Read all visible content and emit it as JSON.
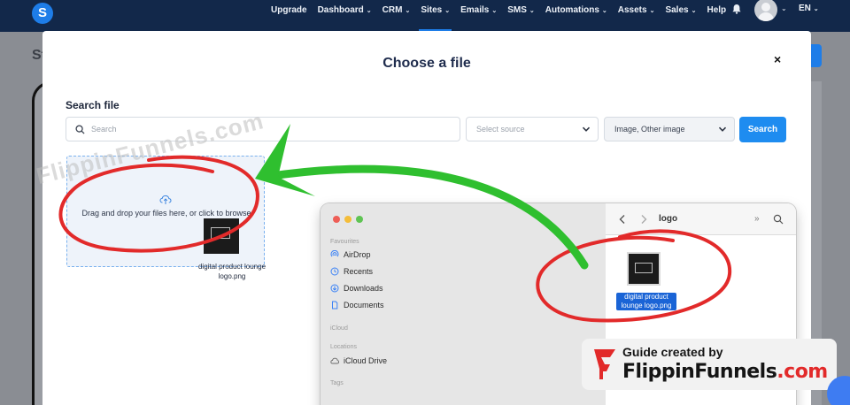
{
  "nav": {
    "logo_letter": "S",
    "items": [
      {
        "label": "Upgrade",
        "dropdown": false
      },
      {
        "label": "Dashboard",
        "dropdown": true
      },
      {
        "label": "CRM",
        "dropdown": true
      },
      {
        "label": "Sites",
        "dropdown": true,
        "active": true
      },
      {
        "label": "Emails",
        "dropdown": true
      },
      {
        "label": "SMS",
        "dropdown": true
      },
      {
        "label": "Automations",
        "dropdown": true
      },
      {
        "label": "Assets",
        "dropdown": true
      },
      {
        "label": "Sales",
        "dropdown": true
      },
      {
        "label": "Help",
        "dropdown": false
      }
    ],
    "language": "EN",
    "icons": {
      "bell": "bell-icon",
      "avatar": "user-avatar"
    }
  },
  "background": {
    "title_fragment": "St"
  },
  "modal": {
    "title": "Choose a file",
    "close_label": "×",
    "search_label": "Search file",
    "search_placeholder": "Search",
    "source_placeholder": "Select source",
    "type_value": "Image, Other image",
    "search_button": "Search",
    "dropzone_text": "Drag and drop your files here, or click to browse",
    "dragged_file_label": "digital product lounge logo.png"
  },
  "finder": {
    "sections": {
      "favourites": "Favourites",
      "icloud": "iCloud",
      "locations": "Locations",
      "tags": "Tags"
    },
    "favourites": [
      "AirDrop",
      "Recents",
      "Downloads",
      "Documents"
    ],
    "locations": [
      "iCloud Drive"
    ],
    "folder_name": "logo",
    "file_label": "digital product lounge logo.png"
  },
  "overlay": {
    "watermark": "FlippinFunnels.com",
    "badge_line1": "Guide created by",
    "badge_brand": "FlippinFunnels",
    "badge_domain": ".com",
    "accent_red": "#e22a2a",
    "accent_green": "#2fbf2f"
  }
}
